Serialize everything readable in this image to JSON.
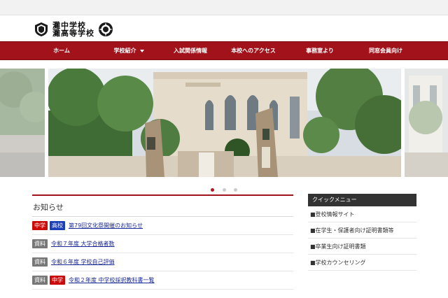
{
  "site": {
    "school_name_1": "灘中学校",
    "school_name_2": "灘高等学校"
  },
  "nav": {
    "items": [
      {
        "label": "ホーム"
      },
      {
        "label": "学校紹介",
        "has_dropdown": true
      },
      {
        "label": "入試関係情報"
      },
      {
        "label": "本校へのアクセス"
      },
      {
        "label": "事務室より"
      },
      {
        "label": "同窓会員向け"
      }
    ]
  },
  "hero": {
    "gate_plate_text": "灘中学校灘高等学校",
    "dot_count": 3,
    "active_dot": 0
  },
  "news": {
    "title": "お知らせ",
    "items": [
      {
        "badges": [
          {
            "text": "中学",
            "color": "red"
          },
          {
            "text": "高校",
            "color": "blue"
          }
        ],
        "text": "第79回文化祭開催のお知らせ"
      },
      {
        "badges": [
          {
            "text": "資料",
            "color": "gray"
          }
        ],
        "text": "令和７年度 大学合格者数"
      },
      {
        "badges": [
          {
            "text": "資料",
            "color": "gray"
          }
        ],
        "text": "令和６年度 学校自己評価"
      },
      {
        "badges": [
          {
            "text": "資料",
            "color": "gray"
          },
          {
            "text": "中学",
            "color": "red"
          }
        ],
        "text": "令和２年度 中学校採択教科書一覧"
      }
    ]
  },
  "quick_menu": {
    "title": "クイックメニュー",
    "items": [
      {
        "label": "■登校情報サイト"
      },
      {
        "label": "■在学生・保護者向け証明書類等"
      },
      {
        "label": "■卒業生向け証明書類"
      },
      {
        "label": "■学校カウンセリング"
      }
    ]
  },
  "colors": {
    "brand_red": "#a2121b",
    "badge_red": "#cc0a0a",
    "badge_blue": "#1c3eb6",
    "badge_gray": "#777777",
    "quick_header": "#333333",
    "link": "#1a2a9a"
  }
}
